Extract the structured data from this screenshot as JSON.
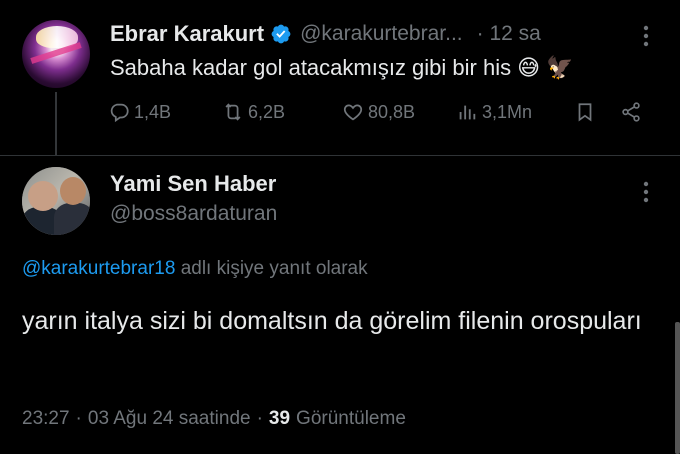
{
  "tweet1": {
    "author_name": "Ebrar Karakurt",
    "handle": "@karakurtebrar...",
    "time": "· 12 sa",
    "text": "Sabaha kadar gol atacakmışız gibi bir his",
    "emoji_sweat": "😅",
    "emoji_eagle": "🦅",
    "replies": "1,4B",
    "retweets": "6,2B",
    "likes": "80,8B",
    "views": "3,1Mn",
    "colors": {
      "verified": "#1d9bf0"
    }
  },
  "tweet2": {
    "author_name": "Yami Sen Haber",
    "handle": "@boss8ardaturan",
    "reply_mention": "@karakurtebrar18",
    "reply_suffix": "adlı kişiye yanıt olarak",
    "text": "yarın italya sizi bi domaltsın da görelim filenin orospuları",
    "time": "23:27",
    "dot1": "·",
    "date": "03 Ağu 24 saatinde",
    "dot2": "·",
    "views_count": "39",
    "views_label": "Görüntüleme"
  },
  "icons": [
    "reply-icon",
    "retweet-icon",
    "like-icon",
    "views-icon",
    "bookmark-icon",
    "share-icon",
    "more-icon",
    "verified-badge-icon"
  ]
}
